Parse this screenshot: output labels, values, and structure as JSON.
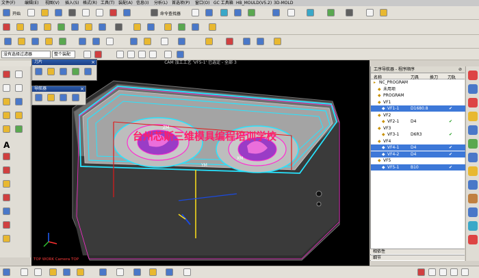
{
  "titlebar": {
    "menus": [
      "文件(F)",
      "编辑(E)",
      "视图(V)",
      "插入(S)",
      "格式(R)",
      "工具(T)",
      "装配(A)",
      "信息(I)",
      "分析(L)",
      "首选项(P)",
      "窗口(O)",
      "GC 工具箱",
      "HB_MOULD(V5.2)",
      "3D-MOLD"
    ]
  },
  "toolbar": {
    "start_label": "开始",
    "command_finder_label": "命令查找器",
    "filter_select": "没有选择过滤器",
    "assembly_select": "整个装配"
  },
  "viewport": {
    "title": "CAM 加工工艺 'VF5-1' 已选定 - 全部 3",
    "watermark": "台州芯斯三维模具编程培训学校",
    "bottom_label": "TOP WORK Camera TOP",
    "labels": [
      "ZM",
      "XM",
      "YM"
    ]
  },
  "panels": {
    "tool_panel": {
      "title": "刀片"
    },
    "navigator_panel": {
      "title": "导航器"
    }
  },
  "navigator": {
    "title": "工序导航器 - 程序顺序",
    "columns": [
      "名称",
      "刀具",
      "换刀",
      "刀轨"
    ],
    "rows": [
      {
        "name": "NC_PROGRAM",
        "tool": "",
        "change": "",
        "path": "",
        "indent": 0,
        "selected": false
      },
      {
        "name": "未用项",
        "tool": "",
        "change": "",
        "path": "",
        "indent": 1,
        "selected": false
      },
      {
        "name": "PROGRAM",
        "tool": "",
        "change": "",
        "path": "",
        "indent": 1,
        "selected": false
      },
      {
        "name": "VF1",
        "tool": "",
        "change": "",
        "path": "",
        "indent": 1,
        "selected": false
      },
      {
        "name": "VF1-1",
        "tool": "D1680.8",
        "change": "",
        "path": "✔",
        "indent": 2,
        "selected": true
      },
      {
        "name": "VF2",
        "tool": "",
        "change": "",
        "path": "",
        "indent": 1,
        "selected": false
      },
      {
        "name": "VF2-1",
        "tool": "D4",
        "change": "",
        "path": "✔",
        "indent": 2,
        "selected": false
      },
      {
        "name": "VF3",
        "tool": "",
        "change": "",
        "path": "",
        "indent": 1,
        "selected": false
      },
      {
        "name": "VF3-1",
        "tool": "D6R3",
        "change": "",
        "path": "✔",
        "indent": 2,
        "selected": false
      },
      {
        "name": "VF4",
        "tool": "",
        "change": "",
        "path": "",
        "indent": 1,
        "selected": false
      },
      {
        "name": "VF4-1",
        "tool": "D4",
        "change": "",
        "path": "✔",
        "indent": 2,
        "selected": true
      },
      {
        "name": "VF4-2",
        "tool": "D4",
        "change": "",
        "path": "✔",
        "indent": 2,
        "selected": true
      },
      {
        "name": "VF5",
        "tool": "",
        "change": "",
        "path": "",
        "indent": 1,
        "selected": false
      },
      {
        "name": "VF5-1",
        "tool": "B10",
        "change": "",
        "path": "✔",
        "indent": 2,
        "selected": true
      }
    ],
    "dependency_label": "相依性",
    "details_label": "细节"
  }
}
